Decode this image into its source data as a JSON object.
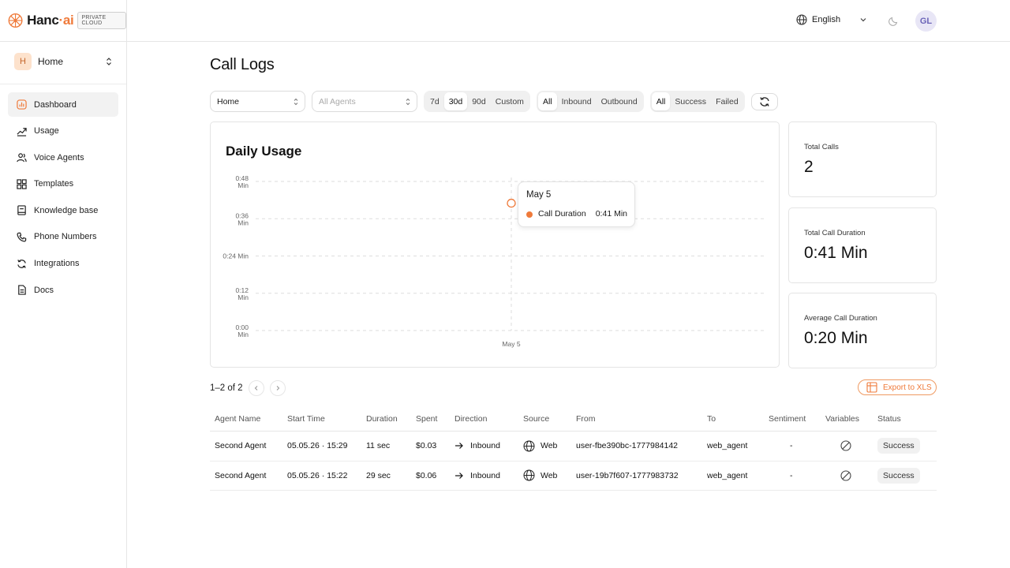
{
  "brand": {
    "name_left": "Hanc",
    "name_dot": "·",
    "name_right": "ai",
    "badge": "PRIVATE CLOUD"
  },
  "workspace": {
    "initial": "H",
    "name": "Home"
  },
  "sidebar": {
    "items": [
      {
        "label": "Dashboard",
        "icon": "dashboard-icon",
        "active": true
      },
      {
        "label": "Usage",
        "icon": "trend-icon"
      },
      {
        "label": "Voice Agents",
        "icon": "users-icon"
      },
      {
        "label": "Templates",
        "icon": "grid-icon"
      },
      {
        "label": "Knowledge base",
        "icon": "book-icon"
      },
      {
        "label": "Phone Numbers",
        "icon": "phone-icon"
      },
      {
        "label": "Integrations",
        "icon": "sync-icon"
      },
      {
        "label": "Docs",
        "icon": "document-icon"
      }
    ]
  },
  "topbar": {
    "language": "English",
    "user_initials": "GL"
  },
  "page": {
    "title": "Call Logs"
  },
  "filters": {
    "workspace_select": "Home",
    "agents_placeholder": "All Agents",
    "ranges": [
      "7d",
      "30d",
      "90d",
      "Custom"
    ],
    "range_selected": "30d",
    "directions": [
      "All",
      "Inbound",
      "Outbound"
    ],
    "direction_selected": "All",
    "statuses": [
      "All",
      "Success",
      "Failed"
    ],
    "status_selected": "All"
  },
  "chart": {
    "title": "Daily Usage",
    "tooltip": {
      "date": "May 5",
      "series": "Call Duration",
      "value": "0:41 Min"
    }
  },
  "chart_data": {
    "type": "line",
    "title": "Daily Usage",
    "x": [
      "May 5"
    ],
    "series": [
      {
        "name": "Call Duration",
        "values": [
          0.41
        ]
      }
    ],
    "yticks": [
      "0:00 Min",
      "0:12 Min",
      "0:24 Min",
      "0:36 Min",
      "0:48 Min"
    ],
    "ylim": [
      0,
      0.48
    ],
    "grid": true
  },
  "stats": [
    {
      "label": "Total Calls",
      "value": "2"
    },
    {
      "label": "Total Call Duration",
      "value": "0:41 Min"
    },
    {
      "label": "Average Call Duration",
      "value": "0:20 Min"
    }
  ],
  "pagination": {
    "text": "1–2 of 2"
  },
  "export_label": "Export to XLS",
  "table": {
    "columns": [
      "Agent Name",
      "Start Time",
      "Duration",
      "Spent",
      "Direction",
      "Source",
      "From",
      "To",
      "Sentiment",
      "Variables",
      "Status"
    ],
    "rows": [
      {
        "agent": "Second Agent",
        "start": "05.05.26 · 15:29",
        "duration": "11 sec",
        "spent": "$0.03",
        "direction": "Inbound",
        "source": "Web",
        "from": "user-fbe390bc-1777984142",
        "to": "web_agent",
        "sentiment": "-",
        "status": "Success"
      },
      {
        "agent": "Second Agent",
        "start": "05.05.26 · 15:22",
        "duration": "29 sec",
        "spent": "$0.06",
        "direction": "Inbound",
        "source": "Web",
        "from": "user-19b7f607-1777983732",
        "to": "web_agent",
        "sentiment": "-",
        "status": "Success"
      }
    ]
  },
  "colors": {
    "accent": "#ef7a3a"
  }
}
